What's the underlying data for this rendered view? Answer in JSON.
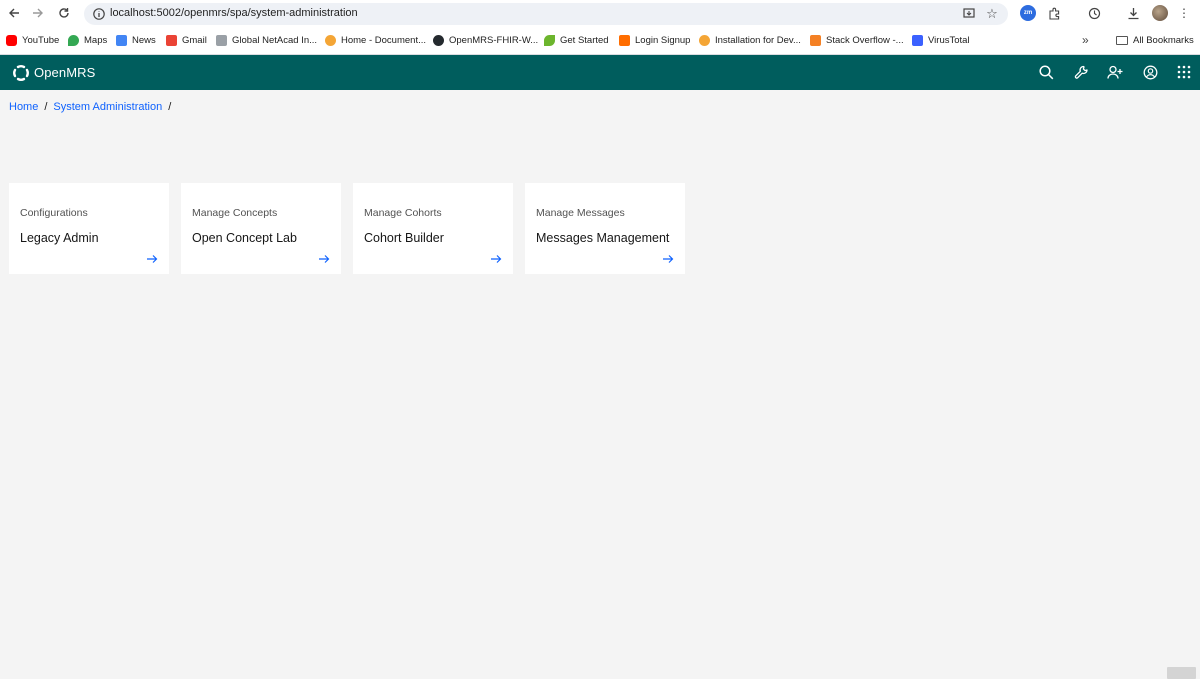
{
  "browser": {
    "url": "localhost:5002/openmrs/spa/system-administration",
    "bookmarks": [
      {
        "label": "YouTube",
        "color": "#ff0000"
      },
      {
        "label": "Maps",
        "color": "#34a853"
      },
      {
        "label": "News",
        "color": "#4285f4"
      },
      {
        "label": "Gmail",
        "color": "#ea4335"
      },
      {
        "label": "Global NetAcad In...",
        "color": "#9aa0a6"
      },
      {
        "label": "Home - Document...",
        "color": "#f4a535"
      },
      {
        "label": "OpenMRS-FHIR-W...",
        "color": "#24292e"
      },
      {
        "label": "Get Started",
        "color": "#6cb52d"
      },
      {
        "label": "Login Signup",
        "color": "#ff6d00"
      },
      {
        "label": "Installation for Dev...",
        "color": "#f4a535"
      },
      {
        "label": "Stack Overflow -...",
        "color": "#f48024"
      },
      {
        "label": "VirusTotal",
        "color": "#3b61ff"
      }
    ],
    "all_bookmarks_label": "All Bookmarks",
    "extension_badge": "zm"
  },
  "app": {
    "name": "OpenMRS",
    "header_color": "#005d5d"
  },
  "breadcrumb": {
    "items": [
      {
        "label": "Home"
      },
      {
        "label": "System Administration"
      }
    ],
    "separator": "/"
  },
  "cards": [
    {
      "header": "Configurations",
      "title": "Legacy Admin"
    },
    {
      "header": "Manage Concepts",
      "title": "Open Concept Lab"
    },
    {
      "header": "Manage Cohorts",
      "title": "Cohort Builder"
    },
    {
      "header": "Manage Messages",
      "title": "Messages Management"
    }
  ],
  "colors": {
    "link": "#0f62fe",
    "page_bg": "#f4f4f4"
  }
}
